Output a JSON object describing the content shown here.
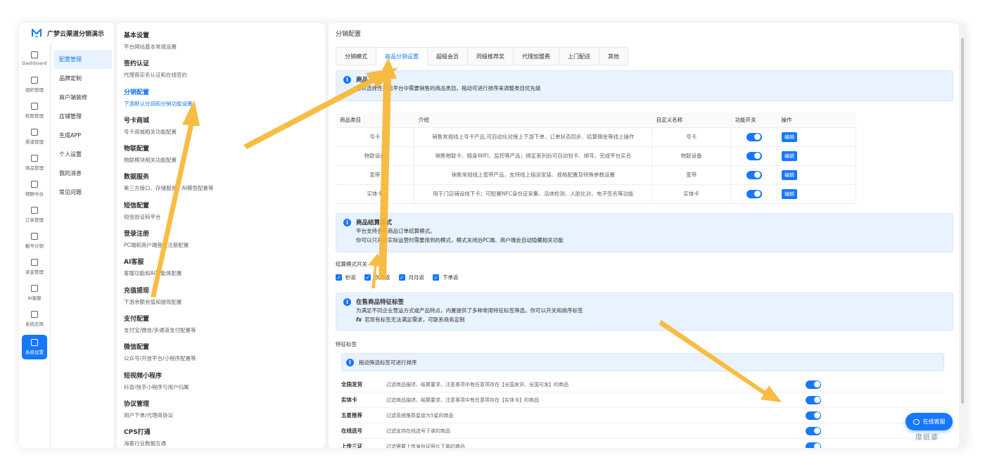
{
  "brand": {
    "name": "广梦云渠道分销演示",
    "logo_color": "#1677ff"
  },
  "rail": [
    {
      "label": "Dashboard",
      "icon": "dashboard-icon"
    },
    {
      "label": "组织管理",
      "icon": "grid-icon"
    },
    {
      "label": "权限管理",
      "icon": "shield-icon"
    },
    {
      "label": "渠道管理",
      "icon": "network-icon"
    },
    {
      "label": "商品管理",
      "icon": "store-icon"
    },
    {
      "label": "物联中台",
      "icon": "iot-icon"
    },
    {
      "label": "订单管理",
      "icon": "list-icon"
    },
    {
      "label": "靓号分销",
      "icon": "phone-icon"
    },
    {
      "label": "资金管理",
      "icon": "wallet-icon"
    },
    {
      "label": "AI客服",
      "icon": "chat-icon"
    },
    {
      "label": "系统应用",
      "icon": "apps-icon"
    },
    {
      "label": "系统设置",
      "icon": "gear-icon"
    }
  ],
  "submenu": [
    "配置管理",
    "品牌定制",
    "商户端装修",
    "店铺管理",
    "生成APP",
    "个人设置",
    "我的消息",
    "常见问题"
  ],
  "settings": [
    {
      "title": "基本设置",
      "desc": "平台网站基本常规设置"
    },
    {
      "title": "签约认证",
      "desc": "代理商实名认证和在线签约"
    },
    {
      "title": "分销配置",
      "desc": "下游默认分润和分销功能设置"
    },
    {
      "title": "号卡商城",
      "desc": "号卡商城相关功能配置"
    },
    {
      "title": "物联配置",
      "desc": "物联模块相关功能配置"
    },
    {
      "title": "数据服务",
      "desc": "第三方接口、存储服务、AI模型配置等"
    },
    {
      "title": "短信配置",
      "desc": "短信验证码平台"
    },
    {
      "title": "登录注册",
      "desc": "PC端和商户端登录注册配置"
    },
    {
      "title": "AI客服",
      "desc": "客服功能和AI智能体配置"
    },
    {
      "title": "充值提现",
      "desc": "下游余额充值和提现配置"
    },
    {
      "title": "支付配置",
      "desc": "支付宝/微信/多通道支付配置等"
    },
    {
      "title": "微信配置",
      "desc": "公众号/开放平台/小程序配置等"
    },
    {
      "title": "短视频小程序",
      "desc": "抖音/快手小程序与用户归属"
    },
    {
      "title": "协议管理",
      "desc": "用户下单/代理商协议"
    },
    {
      "title": "CPS打通",
      "desc": "海客行业数据互通"
    }
  ],
  "main": {
    "title": "分销配置",
    "tabs": [
      "分销模式",
      "商品分销设置",
      "超级会员",
      "同级推荐奖",
      "代理加盟费",
      "上门配送",
      "其他"
    ],
    "info1": {
      "title": "商品",
      "desc": "可以选择性开启平台中需要销售的商品类目。拖动可进行排序来调整类目优先级"
    },
    "table": {
      "headers": [
        "商品类目",
        "介绍",
        "自定义名称",
        "功能开关",
        "操作"
      ],
      "rows": [
        {
          "cat": "号卡",
          "intro": "销售常规线上号卡产品,可自动化对接上下游下单、订单状态同步、结算佣金等线上操作",
          "name": "号卡",
          "op": "编辑"
        },
        {
          "cat": "物联设备",
          "intro": "销售物联卡、随身WIFI、监控等产品；绑定系列后可自动划卡、绑号、完成平台实名",
          "name": "物联设备",
          "op": "编辑"
        },
        {
          "cat": "宽带",
          "intro": "销售常规线上宽带产品，支持线上指派安装、规格配置及特殊参数设置",
          "name": "宽带",
          "op": "编辑"
        },
        {
          "cat": "实体卡",
          "intro": "用于门店铺设线下卡；可配置NFC身份证采集、活体检测、人脸比对、电子签名等功能",
          "name": "实体卡",
          "op": "编辑"
        }
      ]
    },
    "info2": {
      "title": "商品结算模式",
      "line1": "平台支持多种商品订单结算模式。",
      "line2": "你可以只开启实际运营时需要用到的模式，模式关闭后PC端、商户端会自动隐藏相关功能"
    },
    "settle_label": "结算模式开关",
    "settle_options": [
      "秒返",
      "次月返",
      "月月返",
      "下单返"
    ],
    "info3": {
      "title": "在售商品特征标签",
      "line1": "为满足不同企业营运方式或产品特点，内置提供了多种常用特征标签筛选。你可以开关和排序标签",
      "line2": "若现有标签无法满足需求，可联系商务定制"
    },
    "tags_label": "特征标签",
    "drag_tip": "拖动筛选标签可进行排序",
    "tags": [
      {
        "name": "全国发货",
        "desc": "过滤商品描述、结算要求、注意事项中有任意项存在【全国发货、全国可发】的商品"
      },
      {
        "name": "实体卡",
        "desc": "过滤商品描述、结算要求、注意事项中有任意项存在【实体卡】的商品"
      },
      {
        "name": "五星推荐",
        "desc": "过滤系统推荐星级为5星的商品"
      },
      {
        "name": "在线选号",
        "desc": "过滤支持在线选号下单的商品"
      },
      {
        "name": "上传三证",
        "desc": "过滤需要上传身份证照片下单的商品"
      }
    ]
  },
  "kefu": {
    "label": "在线客服"
  },
  "watermark": "度纸婆",
  "accent": "#1677ff",
  "arrow_color": "#f7b733"
}
